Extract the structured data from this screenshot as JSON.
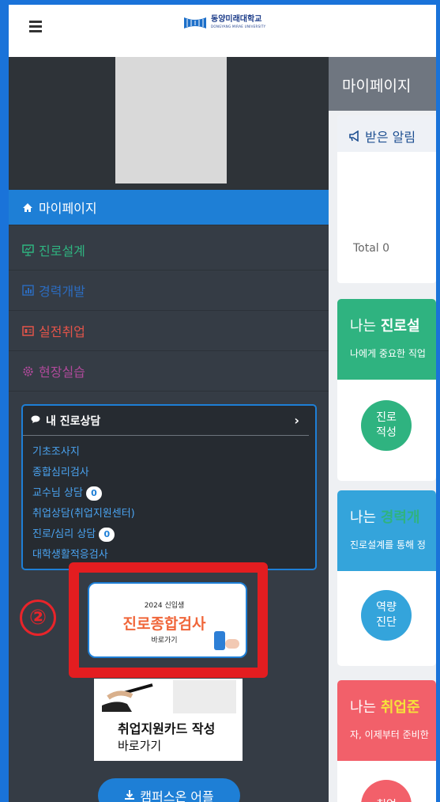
{
  "header": {
    "logo_ko": "동양미래대학교",
    "logo_en": "DONGYANG MIRAE UNIVERSITY"
  },
  "sidebar": {
    "items": [
      {
        "label": "마이페이지",
        "icon": "home-icon",
        "color": "#ffffff"
      },
      {
        "label": "진로설계",
        "icon": "presentation-icon",
        "color": "#2fb380"
      },
      {
        "label": "경력개발",
        "icon": "bar-chart-icon",
        "color": "#2c6cc0"
      },
      {
        "label": "실전취업",
        "icon": "id-card-icon",
        "color": "#e4544a"
      },
      {
        "label": "현장실습",
        "icon": "gear-icon",
        "color": "#b04a9b"
      }
    ],
    "consult": {
      "title": "내 진로상담",
      "links": [
        {
          "label": "기초조사지"
        },
        {
          "label": "종합심리검사"
        },
        {
          "label": "교수님 상담",
          "badge": "0"
        },
        {
          "label": "취업상담(취업지원센터)"
        },
        {
          "label": "진로/심리 상담",
          "badge": "0"
        },
        {
          "label": "대학생활적응검사"
        }
      ]
    },
    "step_marker": "②",
    "banner1": {
      "year": "2024 신입생",
      "title": "진로종합검사",
      "go": "바로가기"
    },
    "banner2": {
      "title": "취업지원카드 작성",
      "go": "바로가기"
    },
    "app_button": "캠퍼스온 어플"
  },
  "content": {
    "page_title": "마이페이지",
    "alert": {
      "title": "받은 알림",
      "total": "Total 0"
    },
    "cards": [
      {
        "title_pre": "나는 ",
        "title_hl": "진로설",
        "subtitle": "나에게 중요한 직업",
        "circle": [
          "진로",
          "적성"
        ],
        "color": "#2fb380"
      },
      {
        "title_pre": "나는 ",
        "title_hl": "경력개",
        "subtitle": "진로설계를 통해 정",
        "circle": [
          "역량",
          "진단"
        ],
        "color": "#34a4db"
      },
      {
        "title_pre": "나는 ",
        "title_hl": "취업준",
        "subtitle": "자, 이제부터 준비한",
        "circle": [
          "취업"
        ],
        "color": "#f2606a"
      }
    ]
  },
  "colors": {
    "accent": "#1e7fd6",
    "highlight_box": "#e31d20"
  }
}
